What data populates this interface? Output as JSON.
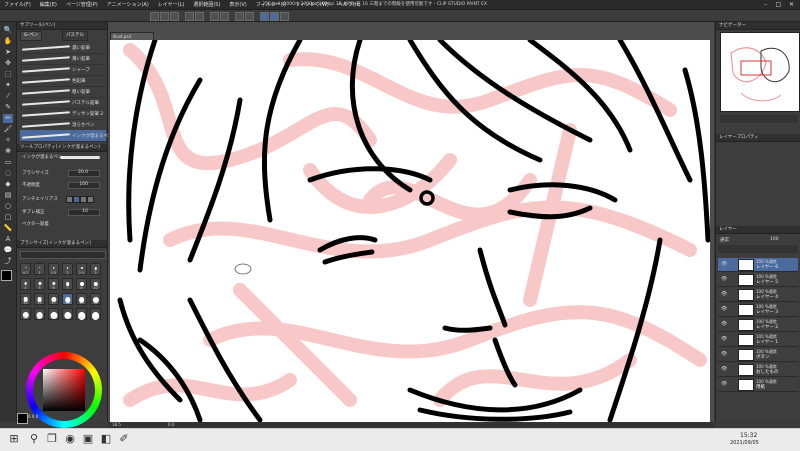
{
  "window": {
    "document_title": "...256.psd (2000 x 2000px 300dpi 18.49%) 正 16 三階までの階級を使用可能です - CLIP STUDIO PAINT EX"
  },
  "menu": [
    "ファイル(F)",
    "編集(E)",
    "ページ管理(P)",
    "アニメーション(A)",
    "レイヤー(L)",
    "選択範囲(S)",
    "表示(V)",
    "フィルター(I)",
    "ウィンドウ(W)",
    "ヘルプ(H)"
  ],
  "window_controls": [
    "–",
    "□",
    "✕"
  ],
  "subtool_panel": {
    "header": "サブツール[ペン]",
    "tabs": [
      "G-ペン",
      "パステル"
    ],
    "brushes": [
      "濃い鉛筆",
      "薄い鉛筆",
      "シャープ",
      "色鉛筆",
      "粗い鉛筆",
      "パステル鉛筆",
      "デッサン鉛筆 2",
      "湿らせペン",
      "インクが溜まるペン"
    ]
  },
  "tool_property": {
    "header": "ツールプロパティ[インクが溜まるペン]",
    "brush_name": "インクが溜まるペン",
    "props": [
      {
        "label": "ブラシサイズ",
        "value": "20.0"
      },
      {
        "label": "不透明度",
        "value": "100"
      },
      {
        "label": "アンチエイリアス",
        "value": ""
      },
      {
        "label": "手ブレ補正",
        "value": "10"
      },
      {
        "label": "ベクター吸着",
        "value": ""
      }
    ]
  },
  "brush_size_panel": {
    "header": "ブラシサイズ[インクが溜まるペン]",
    "sizes": [
      "0.7",
      "1",
      "1.5",
      "2",
      "2.5",
      "3",
      "4",
      "5",
      "6",
      "7",
      "8",
      "10",
      "12",
      "15",
      "17",
      "20",
      "25",
      "30",
      "40",
      "50",
      "60",
      "70",
      "80",
      "100"
    ]
  },
  "color": {
    "main": "#000000",
    "sub": "#ffffff",
    "hue_value": "0 0 0"
  },
  "canvas_tab": "Illust.psd",
  "navigator": {
    "header": "ナビゲーター"
  },
  "layer_panel": {
    "header": "レイヤープロパティ",
    "header2": "レイヤー",
    "blend_mode": "通常",
    "opacity": "100",
    "layers": [
      {
        "percent": "100 %通常",
        "name": "レイヤー 6"
      },
      {
        "percent": "100 %通常",
        "name": "レイヤー 5"
      },
      {
        "percent": "100 %通常",
        "name": "レイヤー 4"
      },
      {
        "percent": "100 %通常",
        "name": "レイヤー 3"
      },
      {
        "percent": "100 %通常",
        "name": "レイヤー 2"
      },
      {
        "percent": "100 %通常",
        "name": "レイヤー 1"
      },
      {
        "percent": "100 %通常",
        "name": "ボタン"
      },
      {
        "percent": "100 %通常",
        "name": "おしたもの"
      },
      {
        "percent": "100 %通常",
        "name": "用紙"
      }
    ]
  },
  "statusbar": {
    "zoom": "18.5",
    "coords": "0.0"
  },
  "taskbar": {
    "time": "15:32",
    "date": "2021/09/05"
  }
}
